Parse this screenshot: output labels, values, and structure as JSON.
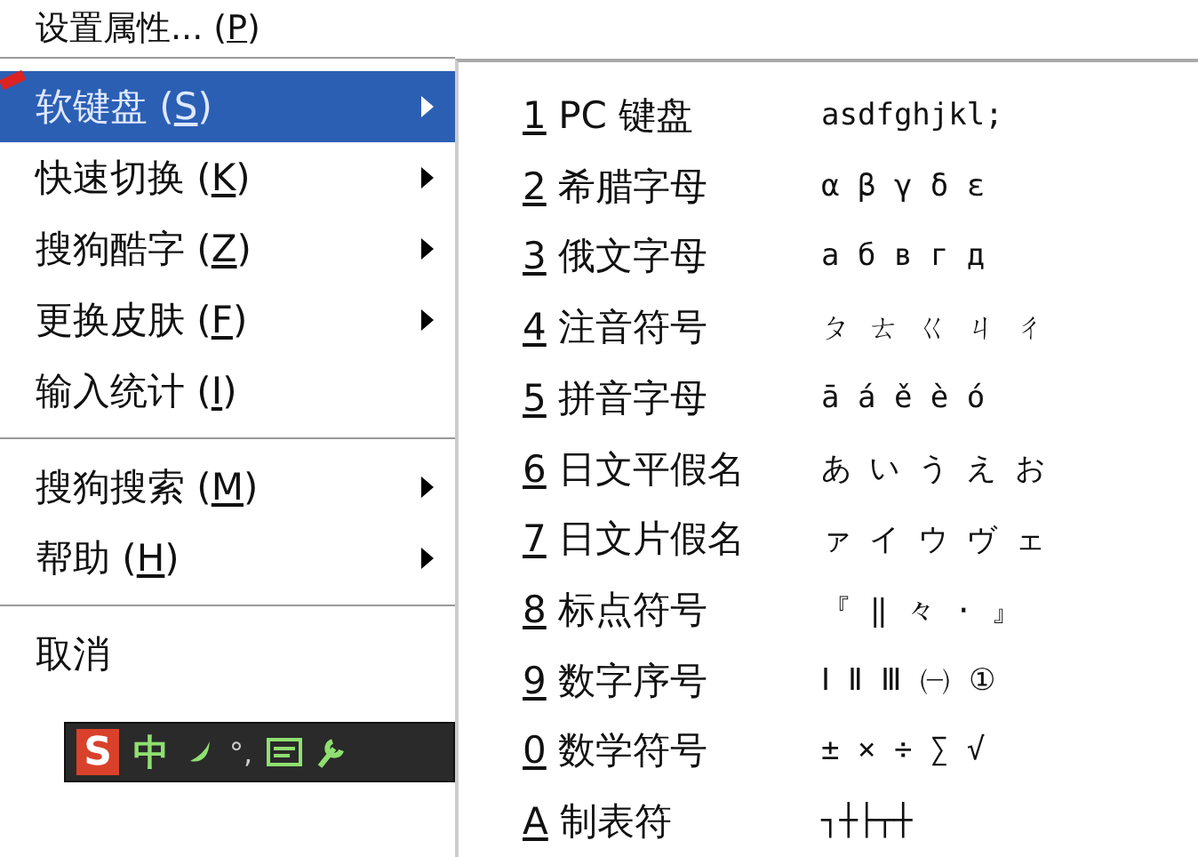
{
  "top_item": {
    "text": "设置属性... (",
    "key": "P",
    "after": ")"
  },
  "menu": [
    [
      {
        "text": "软键盘 (",
        "key": "S",
        "after": ")",
        "has_submenu": true,
        "selected": true
      },
      {
        "text": "快速切换 (",
        "key": "K",
        "after": ")",
        "has_submenu": true,
        "selected": false
      },
      {
        "text": "搜狗酷字 (",
        "key": "Z",
        "after": ")",
        "has_submenu": true,
        "selected": false
      },
      {
        "text": "更换皮肤 (",
        "key": "F",
        "after": ")",
        "has_submenu": true,
        "selected": false
      },
      {
        "text": "输入统计 (",
        "key": "I",
        "after": ")",
        "has_submenu": false,
        "selected": false
      }
    ],
    [
      {
        "text": "搜狗搜索 (",
        "key": "M",
        "after": ")",
        "has_submenu": true,
        "selected": false
      },
      {
        "text": "帮助 (",
        "key": "H",
        "after": ")",
        "has_submenu": true,
        "selected": false
      }
    ],
    [
      {
        "text": "取消",
        "has_submenu": false,
        "selected": false
      }
    ]
  ],
  "status_bar": {
    "logo": "S",
    "mode": "中",
    "punct": "°,"
  },
  "submenu": [
    {
      "key": "1",
      "label": "PC 键盘",
      "sample": "asdfghjkl;"
    },
    {
      "key": "2",
      "label": "希腊字母",
      "sample": "α β γ δ ε"
    },
    {
      "key": "3",
      "label": "俄文字母",
      "sample": "а б в г д"
    },
    {
      "key": "4",
      "label": "注音符号",
      "sample": "ㄆ ㄊ ㄍ ㄐ ㄔ"
    },
    {
      "key": "5",
      "label": "拼音字母",
      "sample": "ā á ě è ó"
    },
    {
      "key": "6",
      "label": "日文平假名",
      "sample": "あ い う え お"
    },
    {
      "key": "7",
      "label": "日文片假名",
      "sample": "ァ イ ウ ヴ ェ"
    },
    {
      "key": "8",
      "label": "标点符号",
      "sample": "『 ‖ 々 · 』"
    },
    {
      "key": "9",
      "label": "数字序号",
      "sample": "Ⅰ Ⅱ Ⅲ ㈠ ①"
    },
    {
      "key": "0",
      "label": "数学符号",
      "sample": "± × ÷ ∑ √"
    },
    {
      "key": "A",
      "label": "制表符",
      "sample": "┐┼├┬┼"
    }
  ]
}
